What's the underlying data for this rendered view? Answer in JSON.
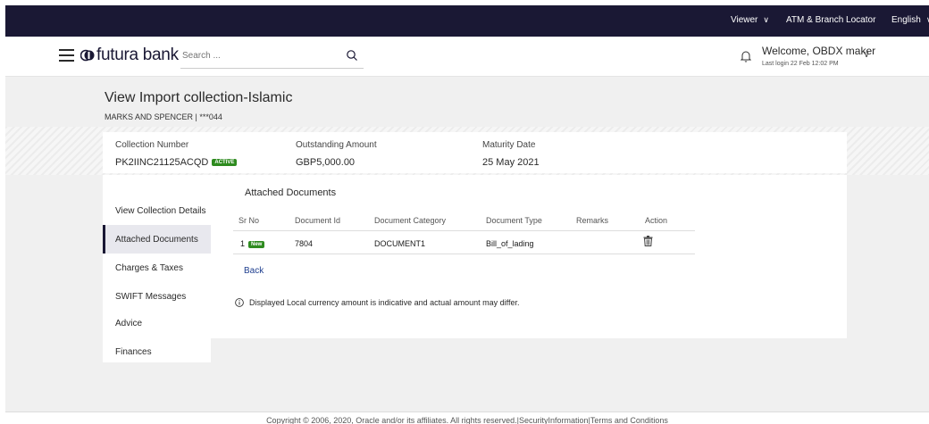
{
  "topbar": {
    "viewer": "Viewer",
    "atm_locator": "ATM & Branch Locator",
    "language": "English"
  },
  "header": {
    "brand": "futura bank",
    "search_placeholder": "Search ...",
    "welcome": "Welcome, OBDX maker",
    "last_login": "Last login 22 Feb 12:02 PM"
  },
  "page": {
    "title": "View Import collection-Islamic",
    "subtitle": "MARKS AND SPENCER | ***044"
  },
  "summary": {
    "collection_number_label": "Collection Number",
    "collection_number": "PK2IINC21125ACQD",
    "status_badge": "ACTIVE",
    "outstanding_label": "Outstanding Amount",
    "outstanding_value": "GBP5,000.00",
    "maturity_label": "Maturity Date",
    "maturity_value": "25 May 2021"
  },
  "side_nav": {
    "items": [
      {
        "label": "View Collection Details"
      },
      {
        "label": "Attached Documents"
      },
      {
        "label": "Charges & Taxes"
      },
      {
        "label": "SWIFT Messages"
      },
      {
        "label": "Advice"
      },
      {
        "label": "Finances"
      }
    ]
  },
  "documents": {
    "title": "Attached Documents",
    "headers": {
      "sr_no": "Sr No",
      "document_id": "Document Id",
      "category": "Document Category",
      "type": "Document Type",
      "remarks": "Remarks",
      "action": "Action"
    },
    "rows": [
      {
        "sr_no": "1",
        "badge": "New",
        "document_id": "7804",
        "category": "DOCUMENT1",
        "type": "Bill_of_lading",
        "remarks": ""
      }
    ]
  },
  "back_label": "Back",
  "info_note": "Displayed Local currency amount is indicative and actual amount may differ.",
  "footer": "Copyright © 2006, 2020, Oracle and/or its affiliates. All rights reserved.|SecurityInformation|Terms and Conditions",
  "colors": {
    "topbar_bg": "#1a1834",
    "badge_green": "#2e8b1f",
    "link_blue": "#1f3f8f"
  }
}
